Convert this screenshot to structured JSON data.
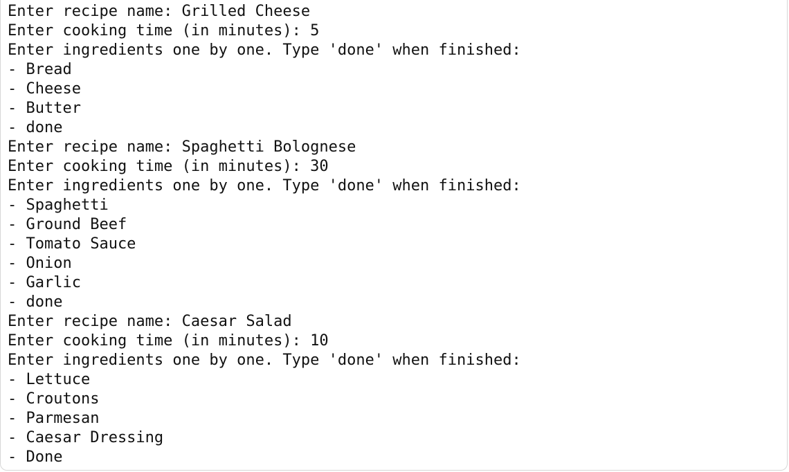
{
  "terminal": {
    "lines": [
      "Enter recipe name: Grilled Cheese",
      "Enter cooking time (in minutes): 5",
      "Enter ingredients one by one. Type 'done' when finished:",
      "- Bread",
      "- Cheese",
      "- Butter",
      "- done",
      "Enter recipe name: Spaghetti Bolognese",
      "Enter cooking time (in minutes): 30",
      "Enter ingredients one by one. Type 'done' when finished:",
      "- Spaghetti",
      "- Ground Beef",
      "- Tomato Sauce",
      "- Onion",
      "- Garlic",
      "- done",
      "Enter recipe name: Caesar Salad",
      "Enter cooking time (in minutes): 10",
      "Enter ingredients one by one. Type 'done' when finished:",
      "- Lettuce",
      "- Croutons",
      "- Parmesan",
      "- Caesar Dressing",
      "- Done"
    ]
  }
}
